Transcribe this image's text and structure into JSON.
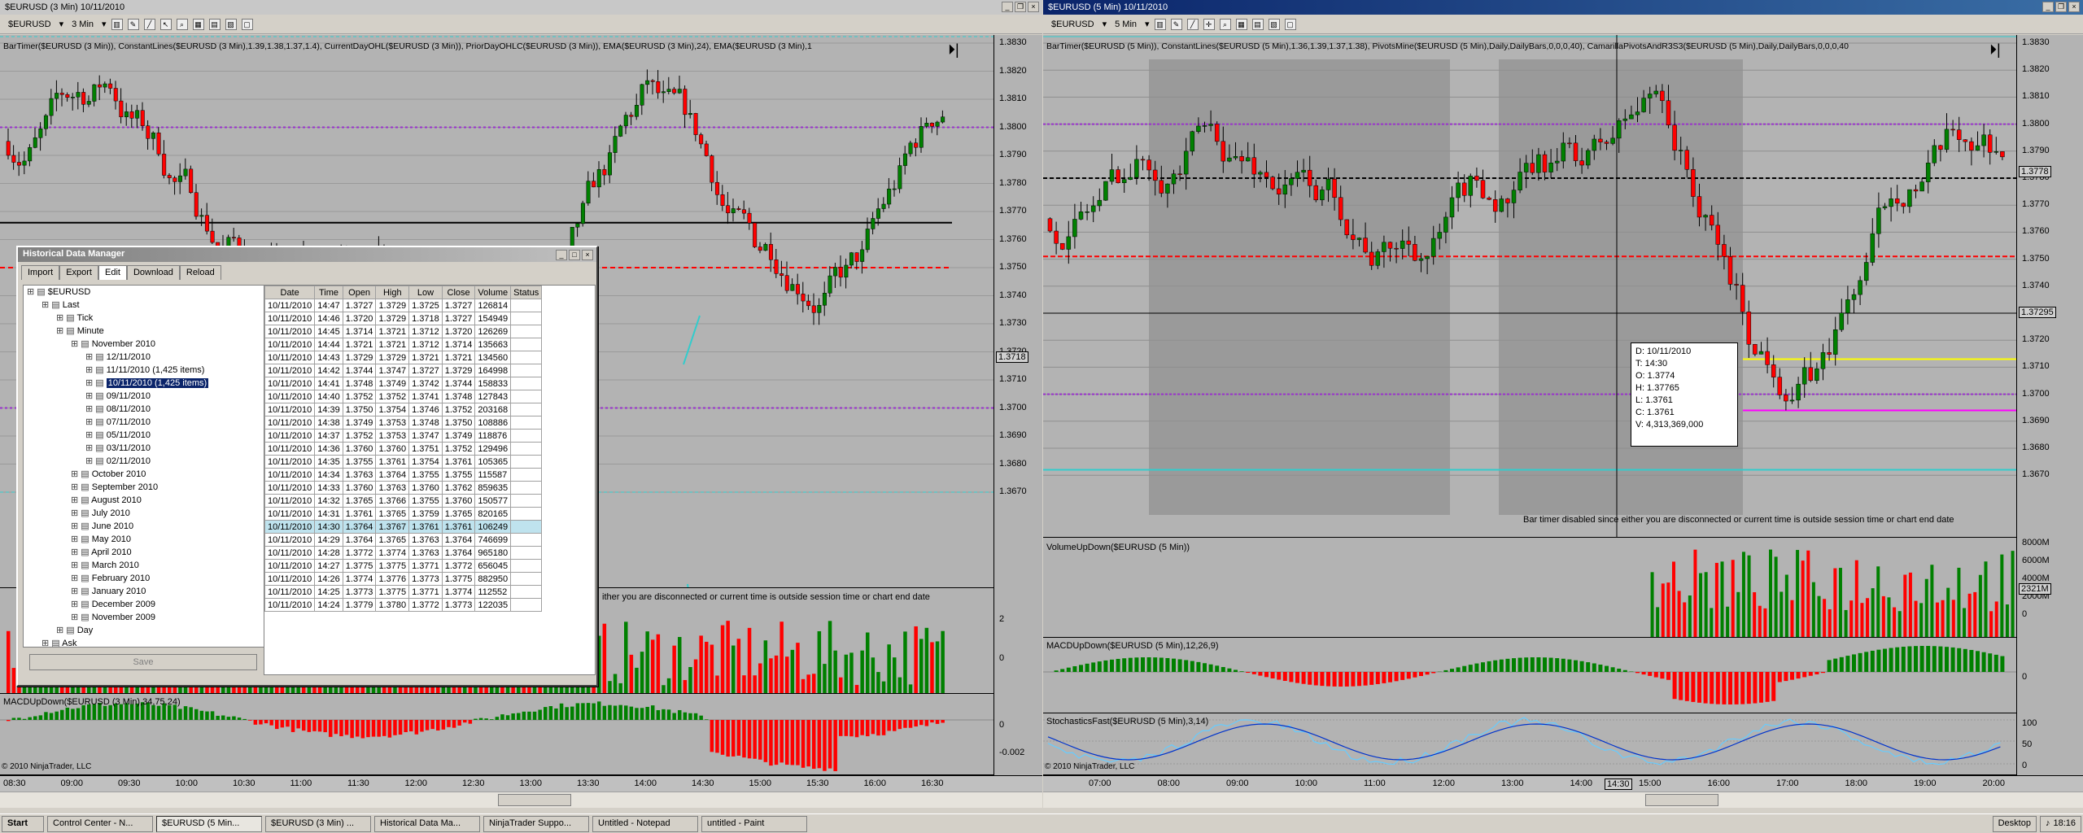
{
  "left_window": {
    "title": "$EURUSD (3 Min)  10/11/2010",
    "instrument": "$EURUSD",
    "interval": "3 Min",
    "indicators_line": "BarTimer($EURUSD (3 Min)), ConstantLines($EURUSD (3 Min),1.39,1.38,1.37,1.4), CurrentDayOHL($EURUSD (3 Min)), PriorDayOHLC($EURUSD (3 Min)), EMA($EURUSD (3 Min),24), EMA($EURUSD (3 Min),1",
    "price_labels": [
      "1.3830",
      "1.3820",
      "1.3810",
      "1.3800",
      "1.3790",
      "1.3780",
      "1.3770",
      "1.3760",
      "1.3750",
      "1.3740",
      "1.3730",
      "1.3720",
      "1.3710",
      "1.3700",
      "1.3690",
      "1.3680",
      "1.3670"
    ],
    "current_price": "1.3718",
    "bar_timer_msg": "ither you are disconnected or current time is outside session time or chart end date",
    "vol_labels": [
      "2",
      "0"
    ],
    "macd_label": "MACDUpDown($EURUSD (3 Min),34,75,24)",
    "macd_axis": [
      "0",
      "-0.002"
    ],
    "copyright": "© 2010 NinjaTrader, LLC",
    "time_labels": [
      "08:30",
      "09:00",
      "09:30",
      "10:00",
      "10:30",
      "11:00",
      "11:30",
      "12:00",
      "12:30",
      "13:00",
      "13:30",
      "14:00",
      "14:30",
      "15:00",
      "15:30",
      "16:00",
      "16:30"
    ]
  },
  "right_window": {
    "title": "$EURUSD (5 Min)  10/11/2010",
    "instrument": "$EURUSD",
    "interval": "5 Min",
    "indicators_line": "BarTimer($EURUSD (5 Min)), ConstantLines($EURUSD (5 Min),1.36,1.39,1.37,1.38), PivotsMine($EURUSD (5 Min),Daily,DailyBars,0,0,0,40),  CamarillaPivotsAndR3S3($EURUSD (5 Min),Daily,DailyBars,0,0,0,40",
    "price_labels": [
      "1.3830",
      "1.3820",
      "1.3810",
      "1.3800",
      "1.3790",
      "1.3780",
      "1.3770",
      "1.3760",
      "1.3750",
      "1.3740",
      "1.3730",
      "1.3720",
      "1.3710",
      "1.3700",
      "1.3690",
      "1.3680",
      "1.3670"
    ],
    "current_price": "1.3778",
    "crosshair_price": "1.37295",
    "tooltip": [
      "D: 10/11/2010",
      "T: 14:30",
      "O: 1.3774",
      "H: 1.37765",
      "L: 1.3761",
      "C: 1.3761",
      "V: 4,313,369,000"
    ],
    "bar_timer_msg": "Bar timer disabled since either you are disconnected or current time is outside session time or chart end date",
    "volume_label": "VolumeUpDown($EURUSD (5 Min))",
    "volume_axis": [
      "8000M",
      "6000M",
      "4000M",
      "2000M",
      "0"
    ],
    "volume_current": "2321M",
    "macd_label": "MACDUpDown($EURUSD (5 Min),12,26,9)",
    "macd_axis": [
      "0"
    ],
    "stoch_label": "StochasticsFast($EURUSD (5 Min),3,14)",
    "stoch_axis": [
      "100",
      "50",
      "0"
    ],
    "copyright": "© 2010 NinjaTrader, LLC",
    "time_labels": [
      "07:00",
      "08:00",
      "09:00",
      "10:00",
      "11:00",
      "12:00",
      "13:00",
      "14:00",
      "15:00",
      "16:00",
      "17:00",
      "18:00",
      "19:00",
      "20:00"
    ],
    "crosshair_time": "14:30"
  },
  "hdm": {
    "title": "Historical Data Manager",
    "tabs": [
      "Import",
      "Export",
      "Edit",
      "Download",
      "Reload"
    ],
    "tree": [
      {
        "indent": 0,
        "text": "$EURUSD"
      },
      {
        "indent": 1,
        "text": "Last"
      },
      {
        "indent": 2,
        "text": "Tick"
      },
      {
        "indent": 2,
        "text": "Minute"
      },
      {
        "indent": 3,
        "text": "November 2010"
      },
      {
        "indent": 4,
        "text": "12/11/2010"
      },
      {
        "indent": 4,
        "text": "11/11/2010 (1,425 items)"
      },
      {
        "indent": 4,
        "text": "10/11/2010 (1,425 items)",
        "selected": true
      },
      {
        "indent": 4,
        "text": "09/11/2010"
      },
      {
        "indent": 4,
        "text": "08/11/2010"
      },
      {
        "indent": 4,
        "text": "07/11/2010"
      },
      {
        "indent": 4,
        "text": "05/11/2010"
      },
      {
        "indent": 4,
        "text": "03/11/2010"
      },
      {
        "indent": 4,
        "text": "02/11/2010"
      },
      {
        "indent": 3,
        "text": "October 2010"
      },
      {
        "indent": 3,
        "text": "September 2010"
      },
      {
        "indent": 3,
        "text": "August 2010"
      },
      {
        "indent": 3,
        "text": "July 2010"
      },
      {
        "indent": 3,
        "text": "June 2010"
      },
      {
        "indent": 3,
        "text": "May 2010"
      },
      {
        "indent": 3,
        "text": "April 2010"
      },
      {
        "indent": 3,
        "text": "March 2010"
      },
      {
        "indent": 3,
        "text": "February 2010"
      },
      {
        "indent": 3,
        "text": "January 2010"
      },
      {
        "indent": 3,
        "text": "December 2009"
      },
      {
        "indent": 3,
        "text": "November 2009"
      },
      {
        "indent": 2,
        "text": "Day"
      },
      {
        "indent": 1,
        "text": "Ask"
      }
    ],
    "columns": [
      "Date",
      "Time",
      "Open",
      "High",
      "Low",
      "Close",
      "Volume",
      "Status"
    ],
    "rows": [
      [
        "10/11/2010",
        "14:47",
        "1.3727",
        "1.3729",
        "1.3725",
        "1.3727",
        "126814",
        ""
      ],
      [
        "10/11/2010",
        "14:46",
        "1.3720",
        "1.3729",
        "1.3718",
        "1.3727",
        "154949",
        ""
      ],
      [
        "10/11/2010",
        "14:45",
        "1.3714",
        "1.3721",
        "1.3712",
        "1.3720",
        "126269",
        ""
      ],
      [
        "10/11/2010",
        "14:44",
        "1.3721",
        "1.3721",
        "1.3712",
        "1.3714",
        "135663",
        ""
      ],
      [
        "10/11/2010",
        "14:43",
        "1.3729",
        "1.3729",
        "1.3721",
        "1.3721",
        "134560",
        ""
      ],
      [
        "10/11/2010",
        "14:42",
        "1.3744",
        "1.3747",
        "1.3727",
        "1.3729",
        "164998",
        ""
      ],
      [
        "10/11/2010",
        "14:41",
        "1.3748",
        "1.3749",
        "1.3742",
        "1.3744",
        "158833",
        ""
      ],
      [
        "10/11/2010",
        "14:40",
        "1.3752",
        "1.3752",
        "1.3741",
        "1.3748",
        "127843",
        ""
      ],
      [
        "10/11/2010",
        "14:39",
        "1.3750",
        "1.3754",
        "1.3746",
        "1.3752",
        "203168",
        ""
      ],
      [
        "10/11/2010",
        "14:38",
        "1.3749",
        "1.3753",
        "1.3748",
        "1.3750",
        "108886",
        ""
      ],
      [
        "10/11/2010",
        "14:37",
        "1.3752",
        "1.3753",
        "1.3747",
        "1.3749",
        "118876",
        ""
      ],
      [
        "10/11/2010",
        "14:36",
        "1.3760",
        "1.3760",
        "1.3751",
        "1.3752",
        "129496",
        ""
      ],
      [
        "10/11/2010",
        "14:35",
        "1.3755",
        "1.3761",
        "1.3754",
        "1.3761",
        "105365",
        ""
      ],
      [
        "10/11/2010",
        "14:34",
        "1.3763",
        "1.3764",
        "1.3755",
        "1.3755",
        "115587",
        ""
      ],
      [
        "10/11/2010",
        "14:33",
        "1.3760",
        "1.3763",
        "1.3760",
        "1.3762",
        "859635",
        ""
      ],
      [
        "10/11/2010",
        "14:32",
        "1.3765",
        "1.3766",
        "1.3755",
        "1.3760",
        "150577",
        ""
      ],
      [
        "10/11/2010",
        "14:31",
        "1.3761",
        "1.3765",
        "1.3759",
        "1.3765",
        "820165",
        ""
      ],
      [
        "10/11/2010",
        "14:30",
        "1.3764",
        "1.3767",
        "1.3761",
        "1.3761",
        "106249",
        ""
      ],
      [
        "10/11/2010",
        "14:29",
        "1.3764",
        "1.3765",
        "1.3763",
        "1.3764",
        "746699",
        ""
      ],
      [
        "10/11/2010",
        "14:28",
        "1.3772",
        "1.3774",
        "1.3763",
        "1.3764",
        "965180",
        ""
      ],
      [
        "10/11/2010",
        "14:27",
        "1.3775",
        "1.3775",
        "1.3771",
        "1.3772",
        "656045",
        ""
      ],
      [
        "10/11/2010",
        "14:26",
        "1.3774",
        "1.3776",
        "1.3773",
        "1.3775",
        "882950",
        ""
      ],
      [
        "10/11/2010",
        "14:25",
        "1.3773",
        "1.3775",
        "1.3771",
        "1.3774",
        "112552",
        ""
      ],
      [
        "10/11/2010",
        "14:24",
        "1.3779",
        "1.3780",
        "1.3772",
        "1.3773",
        "122035",
        ""
      ]
    ],
    "highlight_row": 17,
    "save_label": "Save"
  },
  "taskbar": {
    "start": "Start",
    "items": [
      "Control Center - N...",
      "$EURUSD (5 Min...",
      "$EURUSD (3 Min) ...",
      "Historical Data Ma...",
      "NinjaTrader Suppo...",
      "Untitled - Notepad",
      "untitled - Paint"
    ],
    "active_index": 1,
    "desktop": "Desktop",
    "clock": "18:16"
  },
  "colors": {
    "up": "#008000",
    "down": "#ff0000",
    "purple": "#9933cc",
    "cyan": "#33cccc",
    "chart_bg": "#b3b3b3"
  }
}
